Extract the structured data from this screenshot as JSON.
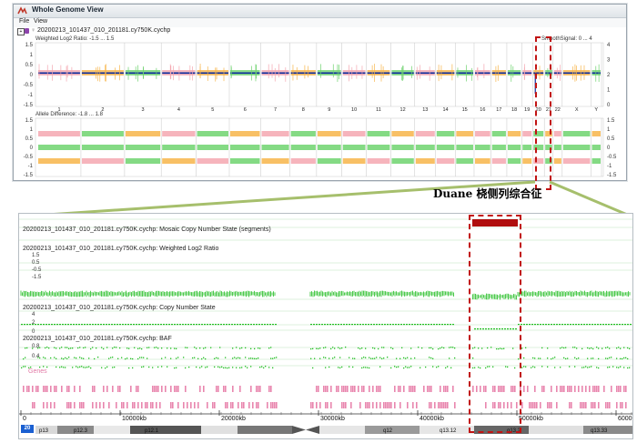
{
  "window": {
    "title": "Whole Genome View",
    "menu": [
      "File",
      "View"
    ],
    "file_name": "20200213_101437_010_201181.cy750K.cychp",
    "smooth_signal_label": "SmoothSignal: 0 ... 4",
    "log2_label": "Weighted Log2 Ratio: -1.5 ... 1.5",
    "allele_label": "Allele Difference: -1.8 ... 1.8",
    "log2_left_ticks": [
      "1.5",
      "1",
      "0.5",
      "0",
      "-0.5",
      "-1",
      "-1.5"
    ],
    "log2_right_ticks": [
      "4",
      "3",
      "2",
      "1",
      "0"
    ],
    "allele_left_ticks": [
      "1.5",
      "1",
      "0.5",
      "0",
      "-0.5",
      "-1",
      "-1.5"
    ],
    "allele_right_ticks": [
      "1.5",
      "1",
      "0.5",
      "0",
      "-0.5",
      "-1",
      "-1.5"
    ],
    "chromosomes": [
      "1",
      "2",
      "3",
      "4",
      "5",
      "6",
      "7",
      "8",
      "9",
      "10",
      "11",
      "12",
      "13",
      "14",
      "15",
      "16",
      "17",
      "18",
      "19",
      "20",
      "21",
      "22",
      "X",
      "Y"
    ]
  },
  "annotation": "Duane 桡侧列综合征",
  "zoom": {
    "tracks": {
      "mosaic": "20200213_101437_010_201181.cy750K.cychp: Mosaic Copy Number State (segments)",
      "log2": "20200213_101437_010_201181.cy750K.cychp: Weighted Log2 Ratio",
      "cn": "20200213_101437_010_201181.cy750K.cychp: Copy Number State",
      "baf": "20200213_101437_010_201181.cy750K.cychp: BAF"
    },
    "log2_ticks": [
      "1.5",
      "0.5",
      "-0.5",
      "-1.5"
    ],
    "cn_ticks": [
      "4",
      "2",
      "0"
    ],
    "baf_ticks": [
      "0.8",
      "0.4"
    ],
    "genes_label": "Genes",
    "kb_ticks": [
      "0",
      "10000kb",
      "20000kb",
      "30000kb",
      "40000kb",
      "50000kb",
      "60000"
    ],
    "chrom_badge": "20",
    "bands": [
      "p13",
      "p12.3",
      "p12.1",
      "q12",
      "q13.12",
      "q13.2",
      "q13.33"
    ]
  },
  "colors": {
    "copy_neutral": "#0b2a9c",
    "loss_pink": "#f4a7b0",
    "gain_orange": "#f7b54a",
    "normal_green": "#6fd36f",
    "zoom_green": "#1fbd1f",
    "gene_pink": "#e886ae",
    "red_highlight": "#c11313",
    "segment_red": "#b00e0e"
  }
}
